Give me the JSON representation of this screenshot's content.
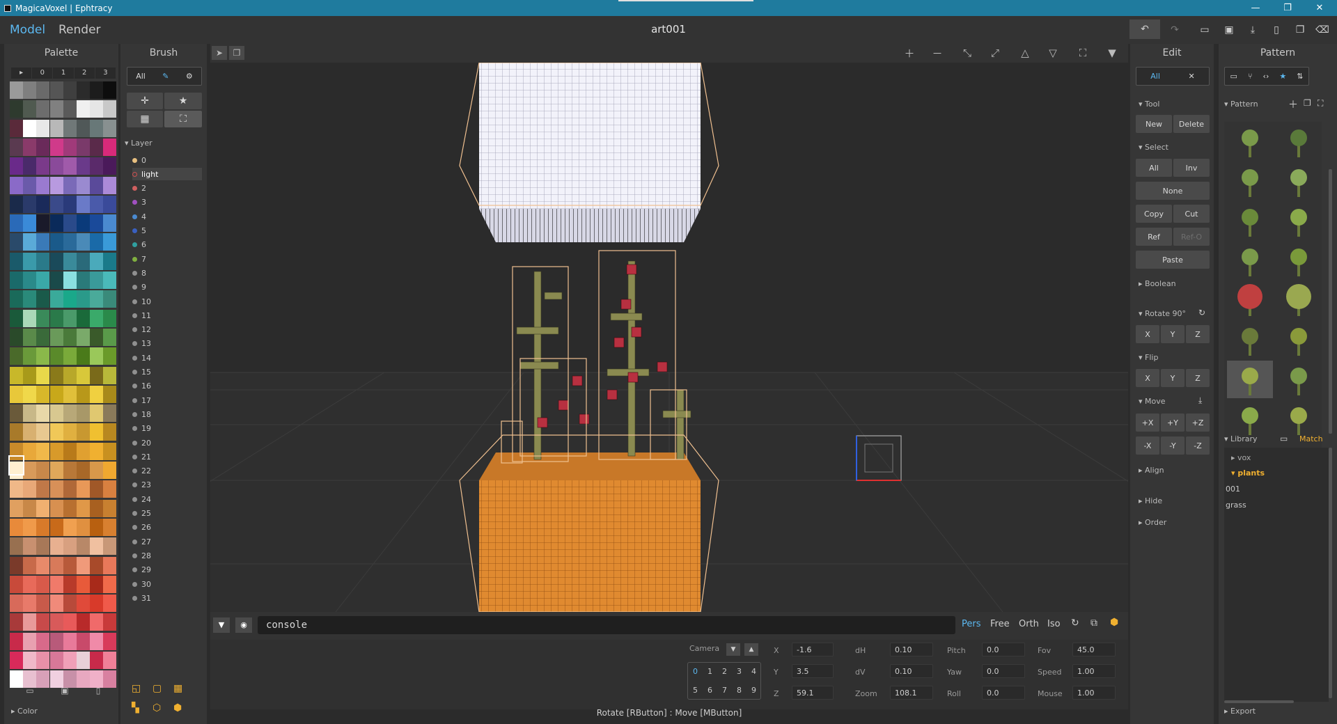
{
  "window": {
    "title": "MagicaVoxel | Ephtracy"
  },
  "topbar": {
    "model": "Model",
    "render": "Render",
    "project": "art001"
  },
  "palette": {
    "title": "Palette",
    "tabs": [
      "▸",
      "0",
      "1",
      "2",
      "3"
    ],
    "footer": "Color",
    "colors": [
      [
        "#9a9a9a",
        "#7f7f7f",
        "#6a6a6a",
        "#555555",
        "#3f3f3f",
        "#2b2b2b",
        "#1c1c1c",
        "#0d0d0d"
      ],
      [
        "#2e3a2e",
        "#505a50",
        "#6d6d6d",
        "#808080",
        "#5a5a5a",
        "#f0f0f0",
        "#e6e6e6",
        "#c8c8c8"
      ],
      [
        "#5a2a3a",
        "#ffffff",
        "#e8e8e8",
        "#b8b8b8",
        "#707878",
        "#505858",
        "#687878",
        "#889090"
      ],
      [
        "#5a3a50",
        "#8a3a6a",
        "#6a2a5a",
        "#d03a8a",
        "#a03a7a",
        "#7a3a6a",
        "#5a2a4a",
        "#d82a7a"
      ],
      [
        "#6a2a8a",
        "#4a2a6a",
        "#7a3a8a",
        "#8a4a9a",
        "#a05aaa",
        "#6a3a8a",
        "#5a2a6a",
        "#4a1a5a"
      ],
      [
        "#8a6ac8",
        "#6a5aaa",
        "#9a7ad0",
        "#b89ae0",
        "#7a6ab8",
        "#9a8ad0",
        "#5a4a9a",
        "#ab8ad8"
      ],
      [
        "#1a2a4a",
        "#2a3a6a",
        "#1a2a5a",
        "#3a4a8a",
        "#2a3a7a",
        "#6a7ac8",
        "#4a5aaa",
        "#3a4a9a"
      ],
      [
        "#2a6ab8",
        "#3a8ad8",
        "#1a1a2a",
        "#0a2a5a",
        "#2a4a8a",
        "#0a3a7a",
        "#1a4a9a",
        "#4a8ad0"
      ],
      [
        "#2a4a6a",
        "#5aaad8",
        "#3a7ab8",
        "#1a5a8a",
        "#2a6a9a",
        "#4a8ab8",
        "#1a6aa8",
        "#3a9ad8"
      ],
      [
        "#1a5a6a",
        "#3a9aaa",
        "#2a7a8a",
        "#1a4a5a",
        "#3a8a9a",
        "#2a6a7a",
        "#4aaabb",
        "#1a7a8a"
      ],
      [
        "#1a6a6a",
        "#2a8a8a",
        "#3aa8a8",
        "#1a4a4a",
        "#8ae0e0",
        "#2a7a7a",
        "#3a9a9a",
        "#4ababa"
      ],
      [
        "#1a6a5a",
        "#2a8a7a",
        "#1a5a4a",
        "#3aaa9a",
        "#1aa88a",
        "#2a9a8a",
        "#4aaa9a",
        "#3a8a7a"
      ],
      [
        "#1a5a3a",
        "#aad8b8",
        "#3a8a5a",
        "#2a7a4a",
        "#4a9a6a",
        "#1a6a3a",
        "#3aaa6a",
        "#2a8a4a"
      ],
      [
        "#2a4a2a",
        "#5a8a4a",
        "#3a6a3a",
        "#6a9a5a",
        "#4a7a3a",
        "#7aaa6a",
        "#3a5a2a",
        "#5a9a4a"
      ],
      [
        "#4a6a2a",
        "#6a9a3a",
        "#8ab84a",
        "#5a8a2a",
        "#7aaa3a",
        "#4a7a1a",
        "#9ac85a",
        "#6a9a2a"
      ],
      [
        "#c8b82a",
        "#a89a1a",
        "#e8d84a",
        "#8a7a1a",
        "#b8a82a",
        "#d8c83a",
        "#7a6a1a",
        "#b8b83a"
      ],
      [
        "#e8c83a",
        "#f0d84a",
        "#d8b82a",
        "#c8a81a",
        "#e0c03a",
        "#b8981a",
        "#f0d040",
        "#a88a1a"
      ],
      [
        "#6a5a3a",
        "#c8b888",
        "#e8d8a8",
        "#d8c890",
        "#b8a878",
        "#a89868",
        "#e0c870",
        "#8a7a5a"
      ],
      [
        "#a87a2a",
        "#d8b070",
        "#e8c890",
        "#f0c858",
        "#e0b040",
        "#c89830",
        "#f0c030",
        "#b88820"
      ],
      [
        "#c88a2a",
        "#e8a83a",
        "#f0b84a",
        "#d89a2a",
        "#b87a1a",
        "#e0a030",
        "#f0b030",
        "#c89020"
      ],
      [
        "#fff0d0",
        "#d89a5a",
        "#c8884a",
        "#e0a85a",
        "#b87838",
        "#a86828",
        "#d8984a",
        "#f0a830"
      ],
      [
        "#f0b888",
        "#e8a878",
        "#c07848",
        "#d89058",
        "#b06838",
        "#e89858",
        "#a05828",
        "#d88040"
      ],
      [
        "#e0a060",
        "#c88848",
        "#f0b070",
        "#d89050",
        "#b87030",
        "#e09848",
        "#a86020",
        "#c88030"
      ],
      [
        "#e88a3a",
        "#f09a4a",
        "#d87a2a",
        "#c86a1a",
        "#f0a050",
        "#e09040",
        "#b86010",
        "#d88030"
      ],
      [
        "#987050",
        "#c89070",
        "#a87858",
        "#e8b090",
        "#d8a080",
        "#b88868",
        "#f0c0a0",
        "#c89878"
      ],
      [
        "#7a3a2a",
        "#c86a4a",
        "#e88a6a",
        "#d87a5a",
        "#b85a3a",
        "#f09a7a",
        "#a84a2a",
        "#e8785a"
      ],
      [
        "#c84a3a",
        "#e86a5a",
        "#d85a4a",
        "#f07a6a",
        "#b83a2a",
        "#e85a3a",
        "#a82a1a",
        "#f06a4a"
      ],
      [
        "#d86a5a",
        "#e87a6a",
        "#c85a4a",
        "#f08a7a",
        "#b84a3a",
        "#e04a3a",
        "#d83a2a",
        "#f05a4a"
      ],
      [
        "#a83a3a",
        "#e89a9a",
        "#c84a4a",
        "#d85a5a",
        "#e85a5a",
        "#b82a2a",
        "#f06a6a",
        "#c83a3a"
      ],
      [
        "#c82a4a",
        "#e8a0b0",
        "#d86a8a",
        "#b85a7a",
        "#e87a9a",
        "#c84a6a",
        "#f08aa8",
        "#d83a5a"
      ],
      [
        "#d82a5a",
        "#f0b8c8",
        "#e890a8",
        "#d87898",
        "#f0a0b8",
        "#e8d0d8",
        "#c82a4a",
        "#f08098"
      ],
      [
        "#ffffff",
        "#e8c0d0",
        "#d8a0b8",
        "#f0d0e0",
        "#c890a8",
        "#e8a8c0",
        "#f0b0c8",
        "#d880a0"
      ]
    ]
  },
  "brush": {
    "title": "Brush",
    "all": "All",
    "layer_heading": "Layer",
    "layers": [
      {
        "name": "0",
        "color": "#e8c080"
      },
      {
        "name": "light",
        "color": "#d05050"
      },
      {
        "name": "2",
        "color": "#d06060"
      },
      {
        "name": "3",
        "color": "#a050c0"
      },
      {
        "name": "4",
        "color": "#4a8ad0"
      },
      {
        "name": "5",
        "color": "#3a60c0"
      },
      {
        "name": "6",
        "color": "#30a0a0"
      },
      {
        "name": "7",
        "color": "#80b040"
      },
      {
        "name": "8",
        "color": "#909090"
      },
      {
        "name": "9",
        "color": "#909090"
      },
      {
        "name": "10",
        "color": "#909090"
      },
      {
        "name": "11",
        "color": "#909090"
      },
      {
        "name": "12",
        "color": "#909090"
      },
      {
        "name": "13",
        "color": "#909090"
      },
      {
        "name": "14",
        "color": "#909090"
      },
      {
        "name": "15",
        "color": "#909090"
      },
      {
        "name": "16",
        "color": "#909090"
      },
      {
        "name": "17",
        "color": "#909090"
      },
      {
        "name": "18",
        "color": "#909090"
      },
      {
        "name": "19",
        "color": "#909090"
      },
      {
        "name": "20",
        "color": "#909090"
      },
      {
        "name": "21",
        "color": "#909090"
      },
      {
        "name": "22",
        "color": "#909090"
      },
      {
        "name": "23",
        "color": "#909090"
      },
      {
        "name": "24",
        "color": "#909090"
      },
      {
        "name": "25",
        "color": "#909090"
      },
      {
        "name": "26",
        "color": "#909090"
      },
      {
        "name": "27",
        "color": "#909090"
      },
      {
        "name": "28",
        "color": "#909090"
      },
      {
        "name": "29",
        "color": "#909090"
      },
      {
        "name": "30",
        "color": "#909090"
      },
      {
        "name": "31",
        "color": "#909090"
      }
    ]
  },
  "console": {
    "value": "console",
    "views": [
      "Pers",
      "Free",
      "Orth",
      "Iso"
    ]
  },
  "status": {
    "hint": "Rotate [RButton] : Move [MButton]"
  },
  "camera": {
    "label": "Camera",
    "slots1": [
      "0",
      "1",
      "2",
      "3",
      "4"
    ],
    "slots2": [
      "5",
      "6",
      "7",
      "8",
      "9"
    ],
    "fields": [
      {
        "label": "X",
        "value": "-1.6"
      },
      {
        "label": "Y",
        "value": "3.5"
      },
      {
        "label": "Z",
        "value": "59.1"
      },
      {
        "label": "dH",
        "value": "0.10"
      },
      {
        "label": "dV",
        "value": "0.10"
      },
      {
        "label": "Zoom",
        "value": "108.1"
      },
      {
        "label": "Pitch",
        "value": "0.0"
      },
      {
        "label": "Yaw",
        "value": "0.0"
      },
      {
        "label": "Roll",
        "value": "0.0"
      },
      {
        "label": "Fov",
        "value": "45.0"
      },
      {
        "label": "Speed",
        "value": "1.00"
      },
      {
        "label": "Mouse",
        "value": "1.00"
      }
    ]
  },
  "edit": {
    "title": "Edit",
    "all": "All",
    "tool": "Tool",
    "new": "New",
    "delete": "Delete",
    "select": "Select",
    "inv": "Inv",
    "none": "None",
    "copy": "Copy",
    "cut": "Cut",
    "ref": "Ref",
    "refo": "Ref-O",
    "paste": "Paste",
    "boolean": "Boolean",
    "rotate": "Rotate 90°",
    "x": "X",
    "y": "Y",
    "z": "Z",
    "flip": "Flip",
    "move": "Move",
    "px": "+X",
    "py": "+Y",
    "pz": "+Z",
    "mx": "-X",
    "my": "-Y",
    "mz": "-Z",
    "align": "Align",
    "hide": "Hide",
    "order": "Order"
  },
  "pattern": {
    "title": "Pattern",
    "section": "Pattern",
    "library": "Library",
    "match": "Match",
    "vox": "vox",
    "plants": "plants",
    "item1": "001",
    "item2": "grass",
    "export": "Export"
  }
}
